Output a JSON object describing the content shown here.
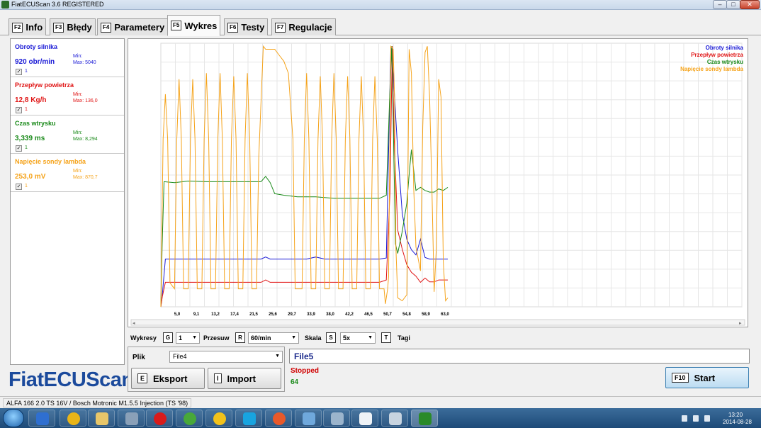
{
  "window": {
    "title": "FiatECUScan 3.6 REGISTERED",
    "min_label": "–",
    "max_label": "□",
    "close_label": "✕"
  },
  "tabs": [
    {
      "key": "F2",
      "label": "Info"
    },
    {
      "key": "F3",
      "label": "Błędy"
    },
    {
      "key": "F4",
      "label": "Parametery"
    },
    {
      "key": "F5",
      "label": "Wykres"
    },
    {
      "key": "F6",
      "label": "Testy"
    },
    {
      "key": "F7",
      "label": "Regulacje"
    }
  ],
  "active_tab": "Wykres",
  "parameters": [
    {
      "name": "Obroty silnika",
      "value": "920 obr/min",
      "min": "Min:",
      "max": "Max: 5040",
      "checked": "✓",
      "num": "1",
      "color": "#1a1ad6"
    },
    {
      "name": "Przepływ powietrza",
      "value": "12,8 Kg/h",
      "min": "Min:",
      "max": "Max: 136,0",
      "checked": "✓",
      "num": "1",
      "color": "#e01515"
    },
    {
      "name": "Czas wtrysku",
      "value": "3,339 ms",
      "min": "Min:",
      "max": "Max: 8,294",
      "checked": "✓",
      "num": "1",
      "color": "#1a8a1a"
    },
    {
      "name": "Napięcie sondy lambda",
      "value": "253,0 mV",
      "min": "Min:",
      "max": "Max: 870,7",
      "checked": "✓",
      "num": "1",
      "color": "#f5a31a"
    }
  ],
  "brand": "FiatECUScan",
  "chart_data": {
    "type": "line",
    "x_ticks": [
      "5,0",
      "9,1",
      "13,2",
      "17,4",
      "21,5",
      "25,6",
      "29,7",
      "33,9",
      "38,0",
      "42,2",
      "46,5",
      "50,7",
      "54,8",
      "58,9",
      "63,0"
    ],
    "xlim": [
      0,
      63
    ],
    "legend": [
      "Obroty silnika",
      "Przepływ powietrza",
      "Czas wtrysku",
      "Napięcie sondy lambda"
    ],
    "legend_position": "top-right",
    "grid": true,
    "series": [
      {
        "name": "Obroty silnika",
        "color": "#1a1ad6",
        "ylim": [
          0,
          5022
        ],
        "points": [
          [
            0,
            0
          ],
          [
            0.3,
            200
          ],
          [
            1,
            920
          ],
          [
            5,
            920
          ],
          [
            8,
            920
          ],
          [
            12,
            920
          ],
          [
            16,
            920
          ],
          [
            20,
            920
          ],
          [
            22,
            920
          ],
          [
            23,
            960
          ],
          [
            24,
            920
          ],
          [
            28,
            920
          ],
          [
            32,
            920
          ],
          [
            34,
            960
          ],
          [
            36,
            920
          ],
          [
            40,
            920
          ],
          [
            44,
            920
          ],
          [
            48,
            920
          ],
          [
            49.5,
            940
          ],
          [
            50.5,
            5000
          ],
          [
            51,
            4500
          ],
          [
            52,
            3000
          ],
          [
            53,
            1800
          ],
          [
            54,
            1300
          ],
          [
            55,
            1100
          ],
          [
            56,
            1000
          ],
          [
            57,
            1300
          ],
          [
            58,
            950
          ],
          [
            59,
            920
          ],
          [
            61,
            920
          ],
          [
            63,
            920
          ]
        ]
      },
      {
        "name": "Przepływ powietrza",
        "color": "#e01515",
        "ylim": [
          0,
          136
        ],
        "points": [
          [
            0,
            0
          ],
          [
            0.3,
            5
          ],
          [
            1,
            12.8
          ],
          [
            5,
            12.8
          ],
          [
            10,
            12.8
          ],
          [
            15,
            12.8
          ],
          [
            22,
            12.8
          ],
          [
            23,
            14
          ],
          [
            24,
            12.8
          ],
          [
            30,
            12.8
          ],
          [
            35,
            12.8
          ],
          [
            40,
            12.8
          ],
          [
            45,
            12.8
          ],
          [
            48,
            12.8
          ],
          [
            49.5,
            14
          ],
          [
            50.3,
            60
          ],
          [
            50.8,
            136
          ],
          [
            51.2,
            90
          ],
          [
            52,
            40
          ],
          [
            53,
            30
          ],
          [
            54,
            22
          ],
          [
            55,
            18
          ],
          [
            56,
            16
          ],
          [
            57,
            12.8
          ],
          [
            58,
            15
          ],
          [
            59,
            13
          ],
          [
            60,
            13
          ],
          [
            61,
            14
          ],
          [
            63,
            14
          ]
        ]
      },
      {
        "name": "Czas wtrysku",
        "color": "#1a8a1a",
        "ylim": [
          0,
          8.294
        ],
        "points": [
          [
            0,
            0
          ],
          [
            0.3,
            2
          ],
          [
            0.7,
            3.98
          ],
          [
            3,
            3.95
          ],
          [
            6,
            4.0
          ],
          [
            10,
            3.98
          ],
          [
            14,
            3.98
          ],
          [
            18,
            3.98
          ],
          [
            22,
            3.98
          ],
          [
            23,
            4.15
          ],
          [
            24,
            3.95
          ],
          [
            25,
            3.6
          ],
          [
            27,
            3.55
          ],
          [
            30,
            3.5
          ],
          [
            34,
            3.5
          ],
          [
            38,
            3.45
          ],
          [
            42,
            3.45
          ],
          [
            46,
            3.45
          ],
          [
            48,
            3.45
          ],
          [
            49.5,
            3.55
          ],
          [
            50.2,
            6.5
          ],
          [
            50.7,
            8.29
          ],
          [
            51,
            6
          ],
          [
            51.5,
            2
          ],
          [
            52,
            1.7
          ],
          [
            53,
            2.4
          ],
          [
            54,
            3.3
          ],
          [
            54.5,
            4.2
          ],
          [
            55,
            5.0
          ],
          [
            56,
            3.7
          ],
          [
            57,
            3.8
          ],
          [
            58,
            3.7
          ],
          [
            59,
            3.65
          ],
          [
            60,
            3.65
          ],
          [
            61,
            3.75
          ],
          [
            62,
            3.7
          ],
          [
            63,
            3.8
          ]
        ]
      },
      {
        "name": "Napięcie sondy lambda",
        "color": "#f5a31a",
        "ylim": [
          0,
          870.7
        ],
        "points": [
          [
            0,
            0
          ],
          [
            0.5,
            560
          ],
          [
            1,
            710
          ],
          [
            1.5,
            560
          ],
          [
            2,
            80
          ],
          [
            3,
            60
          ],
          [
            3.5,
            560
          ],
          [
            4,
            760
          ],
          [
            4.5,
            560
          ],
          [
            5,
            60
          ],
          [
            6,
            60
          ],
          [
            6.5,
            560
          ],
          [
            7,
            760
          ],
          [
            7.5,
            560
          ],
          [
            8,
            60
          ],
          [
            9,
            60
          ],
          [
            9.5,
            560
          ],
          [
            10,
            780
          ],
          [
            10.5,
            560
          ],
          [
            11,
            60
          ],
          [
            12,
            60
          ],
          [
            12.5,
            560
          ],
          [
            13,
            780
          ],
          [
            13.5,
            560
          ],
          [
            14,
            60
          ],
          [
            15,
            60
          ],
          [
            15.5,
            560
          ],
          [
            16,
            770
          ],
          [
            16.5,
            560
          ],
          [
            17,
            60
          ],
          [
            18,
            60
          ],
          [
            18.5,
            560
          ],
          [
            19,
            780
          ],
          [
            19.5,
            560
          ],
          [
            20,
            60
          ],
          [
            21,
            60
          ],
          [
            21.5,
            500
          ],
          [
            22.5,
            870
          ],
          [
            23,
            860
          ],
          [
            25,
            860
          ],
          [
            26,
            840
          ],
          [
            27,
            820
          ],
          [
            28,
            780
          ],
          [
            29,
            560
          ],
          [
            29.5,
            60
          ],
          [
            30,
            60
          ],
          [
            31,
            60
          ],
          [
            31.5,
            560
          ],
          [
            32,
            780
          ],
          [
            32.5,
            560
          ],
          [
            33,
            60
          ],
          [
            34,
            60
          ],
          [
            34.5,
            560
          ],
          [
            35,
            770
          ],
          [
            35.5,
            560
          ],
          [
            36,
            60
          ],
          [
            37,
            60
          ],
          [
            37.5,
            560
          ],
          [
            38,
            780
          ],
          [
            38.5,
            560
          ],
          [
            39,
            60
          ],
          [
            40,
            60
          ],
          [
            40.5,
            560
          ],
          [
            41,
            770
          ],
          [
            41.5,
            560
          ],
          [
            42,
            60
          ],
          [
            43,
            60
          ],
          [
            43.5,
            560
          ],
          [
            44,
            770
          ],
          [
            44.5,
            560
          ],
          [
            45,
            60
          ],
          [
            46,
            60
          ],
          [
            46.5,
            560
          ],
          [
            47,
            770
          ],
          [
            47.5,
            560
          ],
          [
            48,
            60
          ],
          [
            49,
            60
          ],
          [
            49.3,
            10
          ],
          [
            49.8,
            60
          ],
          [
            50,
            100
          ],
          [
            50.5,
            870
          ],
          [
            51,
            860
          ],
          [
            51.3,
            700
          ],
          [
            51.6,
            200
          ],
          [
            52,
            30
          ],
          [
            53,
            20
          ],
          [
            54,
            40
          ],
          [
            54.5,
            860
          ],
          [
            55,
            780
          ],
          [
            55.5,
            400
          ],
          [
            56,
            200
          ],
          [
            57,
            120
          ],
          [
            57.5,
            600
          ],
          [
            58,
            850
          ],
          [
            58.5,
            870
          ],
          [
            59,
            700
          ],
          [
            59.5,
            400
          ],
          [
            60,
            50
          ],
          [
            60.5,
            200
          ],
          [
            61,
            760
          ],
          [
            61.5,
            700
          ],
          [
            62,
            150
          ],
          [
            62.5,
            20
          ],
          [
            63,
            30
          ]
        ]
      }
    ]
  },
  "controls": {
    "wykresy_label": "Wykresy",
    "wykresy_key": "G",
    "wykresy_value": "1",
    "przesuw_label": "Przesuw",
    "przesuw_key": "R",
    "przesuw_value": "60/min",
    "skala_label": "Skala",
    "skala_key": "S",
    "skala_value": "5x",
    "tagi_key": "T",
    "tagi_label": "Tagi"
  },
  "file": {
    "plik_label": "Plik",
    "plik_value": "File4",
    "export_key": "E",
    "export_label": "Eksport",
    "import_key": "I",
    "import_label": "Import",
    "current_file": "File5",
    "status": "Stopped",
    "count": "64",
    "start_key": "F10",
    "start_label": "Start"
  },
  "statusbar": {
    "text": "ALFA 166 2.0 TS 16V / Bosch Motronic M1.5.5 Injection (TS '98)"
  },
  "taskbar": {
    "apps": [
      "start-menu",
      "media-player",
      "chrome",
      "file-explorer",
      "scanner",
      "opera",
      "utorrent",
      "chrome-canary",
      "skype",
      "orbit",
      "paint",
      "printer-app",
      "notepad",
      "calculator",
      "fiatecuscan"
    ],
    "time": "13:20",
    "date": "2014-08-28"
  }
}
